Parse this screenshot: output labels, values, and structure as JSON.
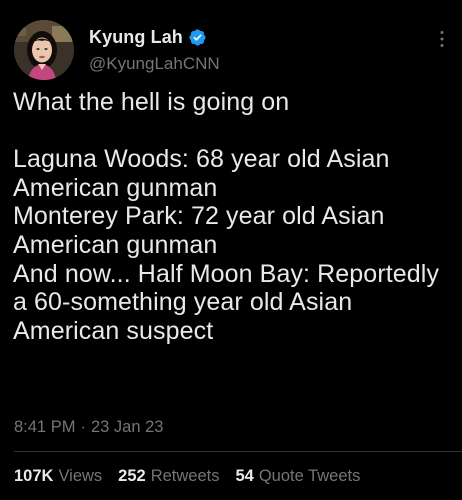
{
  "author": {
    "display_name": "Kyung Lah",
    "handle": "@KyungLahCNN",
    "verified": true,
    "verified_icon": "verified-badge-icon",
    "avatar_icon": "avatar"
  },
  "tweet": {
    "text": "What the hell is going on\n\nLaguna Woods: 68 year old Asian American gunman\nMonterey Park: 72 year old Asian American gunman\nAnd now... Half Moon Bay: Reportedly a 60-something year old Asian American suspect",
    "time": "8:41 PM",
    "separator": "·",
    "date": "23 Jan 23"
  },
  "stats": {
    "views_count": "107K",
    "views_label": "Views",
    "retweets_count": "252",
    "retweets_label": "Retweets",
    "quotes_count": "54",
    "quotes_label": "Quote Tweets"
  },
  "colors": {
    "background": "#000000",
    "primary_text": "#e7e9ea",
    "secondary_text": "#71767b",
    "verified_badge": "#1d9bf0",
    "divider": "#2f3336"
  },
  "menu": {
    "more_icon": "more-vertical-icon"
  }
}
